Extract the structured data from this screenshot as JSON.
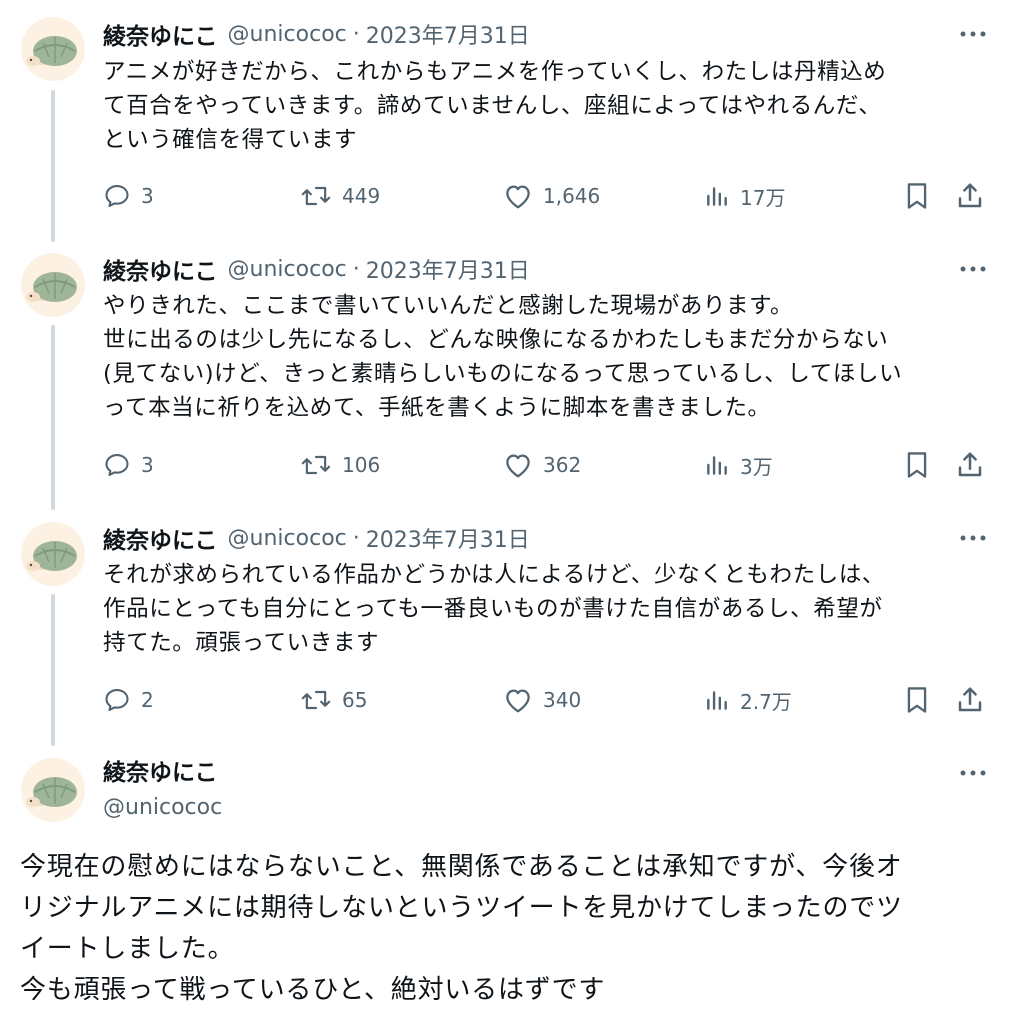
{
  "thread": [
    {
      "display_name": "綾奈ゆにこ",
      "handle": "@unicococ",
      "separator": "·",
      "date": "2023年7月31日",
      "text": "アニメが好きだから、これからもアニメを作っていくし、わたしは丹精込め\nて百合をやっていきます。諦めていませんし、座組によってはやれるんだ、\nという確信を得ています",
      "replies": "3",
      "retweets": "449",
      "likes": "1,646",
      "views": "17万"
    },
    {
      "display_name": "綾奈ゆにこ",
      "handle": "@unicococ",
      "separator": "·",
      "date": "2023年7月31日",
      "text": "やりきれた、ここまで書いていいんだと感謝した現場があります。\n世に出るのは少し先になるし、どんな映像になるかわたしもまだ分からない\n(見てない)けど、きっと素晴らしいものになるって思っているし、してほしい\nって本当に祈りを込めて、手紙を書くように脚本を書きました。",
      "replies": "3",
      "retweets": "106",
      "likes": "362",
      "views": "3万"
    },
    {
      "display_name": "綾奈ゆにこ",
      "handle": "@unicococ",
      "separator": "·",
      "date": "2023年7月31日",
      "text": "それが求められている作品かどうかは人によるけど、少なくともわたしは、\n作品にとっても自分にとっても一番良いものが書けた自信があるし、希望が\n持てた。頑張っていきます",
      "replies": "2",
      "retweets": "65",
      "likes": "340",
      "views": "2.7万"
    }
  ],
  "main_tweet": {
    "display_name": "綾奈ゆにこ",
    "handle": "@unicococ",
    "text": "今現在の慰めにはならないこと、無関係であることは承知ですが、今後オ\nリジナルアニメには期待しないというツイートを見かけてしまったのでツ\nイートしました。\n今も頑張って戦っているひと、絶対いるはずです"
  },
  "icons": {
    "avatar": "turtle-avatar",
    "more": "more-icon",
    "reply": "reply-icon",
    "retweet": "retweet-icon",
    "like": "heart-icon",
    "views": "views-icon",
    "bookmark": "bookmark-icon",
    "share": "share-icon"
  },
  "colors": {
    "text_primary": "#0f1419",
    "text_secondary": "#536471",
    "thread_line": "#cfd9de",
    "avatar_shell": "#9fb59a",
    "avatar_bg": "#fdf1e4"
  }
}
